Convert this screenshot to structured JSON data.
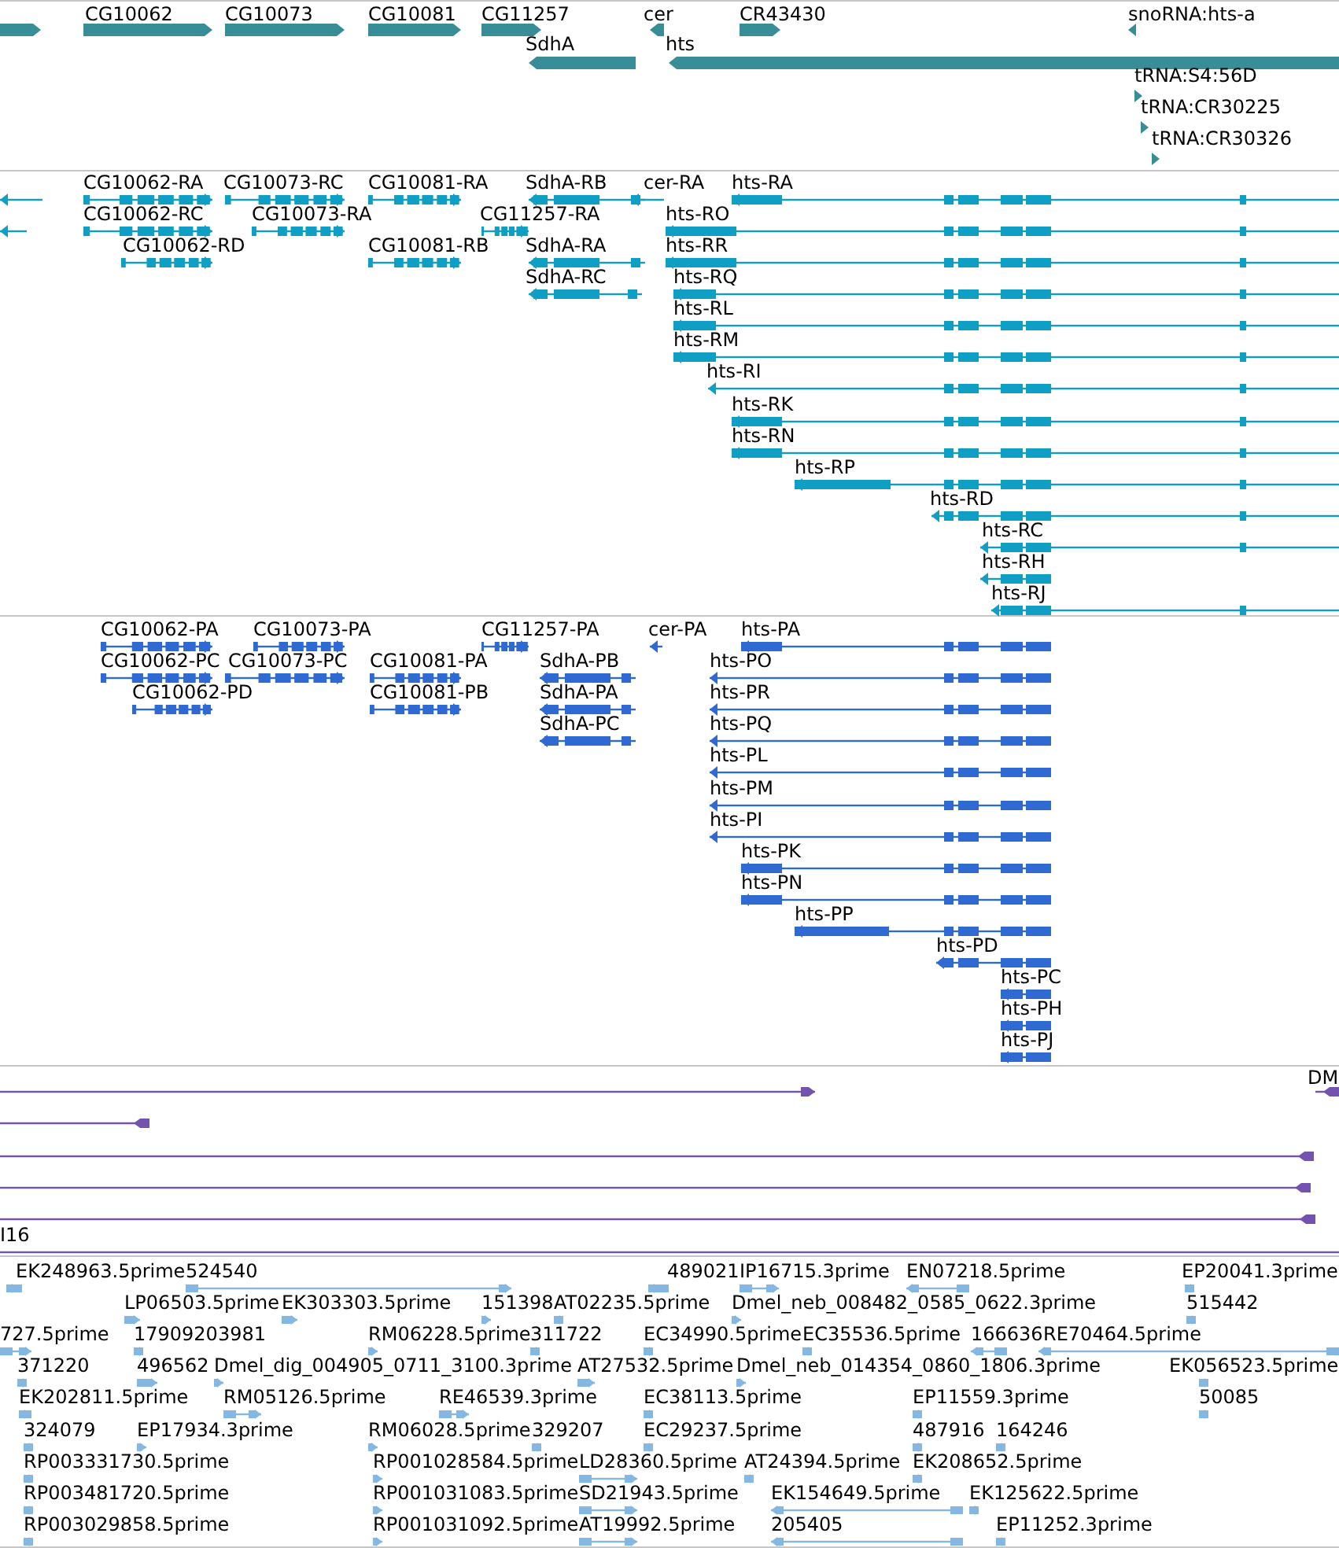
{
  "tracks": [
    {
      "kind": "gene",
      "features": [
        {
          "reverse": false
        },
        {
          "label": "CG10062",
          "reverse": false
        },
        {
          "label": "CG10073",
          "reverse": false
        },
        {
          "label": "CG10081",
          "reverse": false
        },
        {
          "label": "CG11257",
          "reverse": false
        },
        {
          "label": "cer",
          "reverse": true
        },
        {
          "label": "CR43430",
          "reverse": false
        },
        {
          "label": "snoRNA:hts-a",
          "reverse": true
        },
        {
          "label": "SdhA",
          "reverse": true
        },
        {
          "label": "hts",
          "reverse": true
        },
        {
          "label": "tRNA:S4:56D",
          "reverse": false
        },
        {
          "label": "tRNA:CR30225",
          "reverse": false
        },
        {
          "label": "tRNA:CR30326",
          "reverse": false
        }
      ]
    },
    {
      "kind": "transcript",
      "features": [
        {
          "reverse": true
        },
        {
          "label": "CG10062-RA",
          "reverse": false
        },
        {
          "label": "CG10073-RC",
          "reverse": false
        },
        {
          "label": "CG10081-RA",
          "reverse": false
        },
        {
          "label": "SdhA-RB",
          "reverse": true
        },
        {
          "label": "cer-RA",
          "reverse": true
        },
        {
          "label": "hts-RA",
          "reverse": true
        },
        {
          "reverse": true
        },
        {
          "label": "CG10062-RC",
          "reverse": false
        },
        {
          "label": "CG10073-RA",
          "reverse": false
        },
        {
          "label": "CG11257-RA",
          "reverse": false
        },
        {
          "label": "hts-RO",
          "reverse": true
        },
        {
          "label": "CG10062-RD",
          "reverse": false
        },
        {
          "label": "CG10081-RB",
          "reverse": false
        },
        {
          "label": "SdhA-RA",
          "reverse": true
        },
        {
          "label": "hts-RR",
          "reverse": true
        },
        {
          "label": "SdhA-RC",
          "reverse": true
        },
        {
          "label": "hts-RQ",
          "reverse": true
        },
        {
          "label": "hts-RL",
          "reverse": true
        },
        {
          "label": "hts-RM",
          "reverse": true
        },
        {
          "label": "hts-RI",
          "reverse": true
        },
        {
          "label": "hts-RK",
          "reverse": true
        },
        {
          "label": "hts-RN",
          "reverse": true
        },
        {
          "label": "hts-RP",
          "reverse": true
        },
        {
          "label": "hts-RD",
          "reverse": true
        },
        {
          "label": "hts-RC",
          "reverse": true
        },
        {
          "label": "hts-RH",
          "reverse": true
        },
        {
          "label": "hts-RJ",
          "reverse": true
        }
      ]
    },
    {
      "kind": "protein",
      "features": [
        {
          "label": "CG10062-PA",
          "reverse": false
        },
        {
          "label": "CG10073-PA",
          "reverse": false
        },
        {
          "label": "CG11257-PA",
          "reverse": false
        },
        {
          "label": "cer-PA",
          "reverse": true
        },
        {
          "label": "hts-PA",
          "reverse": true
        },
        {
          "label": "CG10062-PC",
          "reverse": false
        },
        {
          "label": "CG10073-PC",
          "reverse": false
        },
        {
          "label": "CG10081-PA",
          "reverse": false
        },
        {
          "label": "SdhA-PB",
          "reverse": true
        },
        {
          "label": "hts-PO",
          "reverse": true
        },
        {
          "label": "CG10062-PD",
          "reverse": false
        },
        {
          "label": "CG10081-PB",
          "reverse": false
        },
        {
          "label": "SdhA-PA",
          "reverse": true
        },
        {
          "label": "hts-PR",
          "reverse": true
        },
        {
          "label": "SdhA-PC",
          "reverse": true
        },
        {
          "label": "hts-PQ",
          "reverse": true
        },
        {
          "label": "hts-PL",
          "reverse": true
        },
        {
          "label": "hts-PM",
          "reverse": true
        },
        {
          "label": "hts-PI",
          "reverse": true
        },
        {
          "label": "hts-PK",
          "reverse": true
        },
        {
          "label": "hts-PN",
          "reverse": true
        },
        {
          "label": "hts-PP",
          "reverse": true
        },
        {
          "label": "hts-PD",
          "reverse": true
        },
        {
          "label": "hts-PC",
          "reverse": true
        },
        {
          "label": "hts-PH",
          "reverse": true
        },
        {
          "label": "hts-PJ",
          "reverse": true
        }
      ]
    },
    {
      "kind": "alignment",
      "features": [
        {
          "reverse": false
        },
        {
          "label": "DM",
          "reverse": true
        },
        {
          "reverse": true
        },
        {
          "reverse": true
        },
        {
          "reverse": true
        },
        {
          "reverse": true
        },
        {
          "label": "I16"
        }
      ]
    },
    {
      "kind": "est",
      "features": [
        {
          "label": "EK248963.5prime",
          "reverse": true
        },
        {
          "label": "524540",
          "reverse": false
        },
        {
          "label": "489021",
          "reverse": true
        },
        {
          "label": "IP16715.3prime",
          "reverse": false
        },
        {
          "label": "EN07218.5prime",
          "reverse": true
        },
        {
          "label": "EP20041.3prime",
          "reverse": true
        },
        {
          "label": "LP06503.5prime",
          "reverse": false
        },
        {
          "label": "EK303303.5prime",
          "reverse": false
        },
        {
          "label": "151398",
          "reverse": false
        },
        {
          "label": "AT02235.5prime",
          "reverse": true
        },
        {
          "label": "Dmel_neb_008482_0585_0622.3prime",
          "reverse": false
        },
        {
          "label": "515442",
          "reverse": true
        },
        {
          "label": "727.5prime",
          "reverse": false
        },
        {
          "label": "17909203981",
          "reverse": true
        },
        {
          "label": "RM06228.5prime",
          "reverse": false
        },
        {
          "label": "311722",
          "reverse": true
        },
        {
          "label": "EC34990.5prime",
          "reverse": true
        },
        {
          "label": "EC35536.5prime",
          "reverse": true
        },
        {
          "label": "166636",
          "reverse": true
        },
        {
          "label": "RE70464.5prime",
          "reverse": true
        },
        {
          "label": "371220",
          "reverse": true
        },
        {
          "label": "496562",
          "reverse": false
        },
        {
          "label": "Dmel_dig_004905_0711_3100.3prime",
          "reverse": false
        },
        {
          "label": "AT27532.5prime",
          "reverse": false
        },
        {
          "label": "Dmel_neb_014354_0860_1806.3prime",
          "reverse": false
        },
        {
          "label": "EK056523.5prime",
          "reverse": true
        },
        {
          "label": "EK202811.5prime",
          "reverse": true
        },
        {
          "label": "RM05126.5prime",
          "reverse": false
        },
        {
          "label": "RE46539.3prime",
          "reverse": false
        },
        {
          "label": "EC38113.5prime",
          "reverse": true
        },
        {
          "label": "EP11559.3prime",
          "reverse": true
        },
        {
          "label": "50085",
          "reverse": true
        },
        {
          "label": "324079",
          "reverse": true
        },
        {
          "label": "EP17934.3prime",
          "reverse": false
        },
        {
          "label": "RM06028.5prime",
          "reverse": false
        },
        {
          "label": "329207",
          "reverse": true
        },
        {
          "label": "EC29237.5prime",
          "reverse": true
        },
        {
          "label": "487916",
          "reverse": true
        },
        {
          "label": "164246",
          "reverse": true
        },
        {
          "label": "RP003331730.5prime",
          "reverse": true
        },
        {
          "label": "RP001028584.5prime",
          "reverse": false
        },
        {
          "label": "LD28360.5prime",
          "reverse": false
        },
        {
          "label": "AT24394.5prime",
          "reverse": true
        },
        {
          "label": "EK208652.5prime",
          "reverse": true
        },
        {
          "label": "RP003481720.5prime",
          "reverse": true
        },
        {
          "label": "RP001031083.5prime",
          "reverse": false
        },
        {
          "label": "SD21943.5prime",
          "reverse": false
        },
        {
          "label": "EK154649.5prime",
          "reverse": true
        },
        {
          "label": "EK125622.5prime",
          "reverse": true
        },
        {
          "label": "RP003029858.5prime",
          "reverse": true
        },
        {
          "label": "RP001031092.5prime",
          "reverse": false
        },
        {
          "label": "AT19992.5prime",
          "reverse": false
        },
        {
          "label": "205405",
          "reverse": true
        },
        {
          "label": "EP11252.3prime",
          "reverse": true
        }
      ]
    }
  ]
}
